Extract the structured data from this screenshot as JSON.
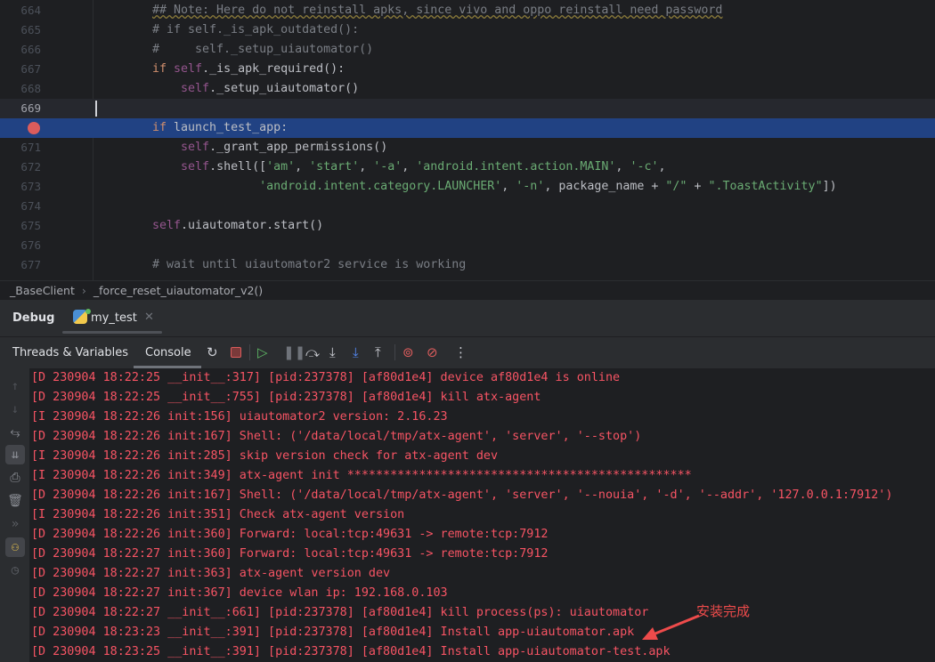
{
  "editor": {
    "lines": [
      {
        "num": "664",
        "code": "## Note: Here do not reinstall apks, since vivo and oppo reinstall need password"
      },
      {
        "num": "665",
        "code": "# if self._is_apk_outdated():"
      },
      {
        "num": "666",
        "code": "#     self._setup_uiautomator()"
      },
      {
        "num": "667",
        "code": "if self._is_apk_required():"
      },
      {
        "num": "668",
        "code": "    self._setup_uiautomator()"
      },
      {
        "num": "669",
        "code": ""
      },
      {
        "num": "",
        "code": "if launch_test_app:"
      },
      {
        "num": "671",
        "code": "    self._grant_app_permissions()"
      },
      {
        "num": "672",
        "code": "    self.shell(['am', 'start', '-a', 'android.intent.action.MAIN', '-c',"
      },
      {
        "num": "673",
        "code": "               'android.intent.category.LAUNCHER', '-n', package_name + \"/\" + \".ToastActivity\"])"
      },
      {
        "num": "674",
        "code": ""
      },
      {
        "num": "675",
        "code": "self.uiautomator.start()"
      },
      {
        "num": "676",
        "code": ""
      },
      {
        "num": "677",
        "code": "# wait until uiautomator2 service is working"
      }
    ],
    "current_line": "669",
    "breakpoint_line": "670"
  },
  "breadcrumb": {
    "class": "_BaseClient",
    "method": "_force_reset_uiautomator_v2()"
  },
  "debug": {
    "title": "Debug",
    "session": "my_test"
  },
  "toolbar": {
    "threads_tab": "Threads & Variables",
    "console_tab": "Console"
  },
  "console": {
    "lines": [
      "[D 230904 18:22:25 __init__:317] [pid:237378] [af80d1e4] device af80d1e4 is online",
      "[D 230904 18:22:25 __init__:755] [pid:237378] [af80d1e4] kill atx-agent",
      "[I 230904 18:22:26 init:156] uiautomator2 version: 2.16.23",
      "[D 230904 18:22:26 init:167] Shell: ('/data/local/tmp/atx-agent', 'server', '--stop')",
      "[I 230904 18:22:26 init:285] skip version check for atx-agent dev",
      "[I 230904 18:22:26 init:349] atx-agent init ************************************************",
      "[D 230904 18:22:26 init:167] Shell: ('/data/local/tmp/atx-agent', 'server', '--nouia', '-d', '--addr', '127.0.0.1:7912')",
      "[I 230904 18:22:26 init:351] Check atx-agent version",
      "[D 230904 18:22:26 init:360] Forward: local:tcp:49631 -> remote:tcp:7912",
      "[D 230904 18:22:27 init:360] Forward: local:tcp:49631 -> remote:tcp:7912",
      "[D 230904 18:22:27 init:363] atx-agent version dev",
      "[D 230904 18:22:27 init:367] device wlan ip: 192.168.0.103",
      "[D 230904 18:22:27 __init__:661] [pid:237378] [af80d1e4] kill process(ps): uiautomator",
      "[D 230904 18:23:23 __init__:391] [pid:237378] [af80d1e4] Install app-uiautomator.apk",
      "[D 230904 18:23:25 __init__:391] [pid:237378] [af80d1e4] Install app-uiautomator-test.apk"
    ]
  },
  "annotation": {
    "text": "安装完成",
    "color": "#ee4b4b"
  },
  "colors": {
    "log": "#f75464",
    "selection": "#214283",
    "breakpoint": "#db5c5c"
  }
}
